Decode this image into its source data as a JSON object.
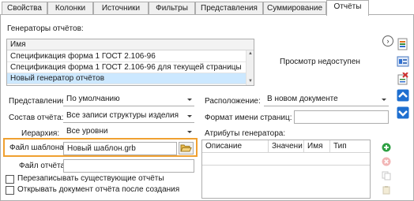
{
  "tabs": [
    {
      "label": "Свойства",
      "active": false
    },
    {
      "label": "Колонки",
      "active": false
    },
    {
      "label": "Источники",
      "active": false
    },
    {
      "label": "Фильтры",
      "active": false
    },
    {
      "label": "Представления",
      "active": false
    },
    {
      "label": "Суммирование",
      "active": false
    },
    {
      "label": "Отчёты",
      "active": true
    }
  ],
  "generators": {
    "title": "Генераторы отчётов:",
    "column_header": "Имя",
    "rows": [
      {
        "name": "Спецификация форма 1 ГОСТ 2.106-96",
        "selected": false
      },
      {
        "name": "Спецификация форма 1 ГОСТ 2.106-96 для текущей страницы",
        "selected": false
      },
      {
        "name": "Новый генератор отчётов",
        "selected": true
      }
    ]
  },
  "preview_text": "Просмотр недоступен",
  "form": {
    "representation_label": "Представление:",
    "representation_value": "По умолчанию",
    "composition_label": "Состав отчёта:",
    "composition_value": "Все записи структуры изделия",
    "hierarchy_label": "Иерархия:",
    "hierarchy_value": "Все уровни",
    "template_label": "Файл шаблона:",
    "template_value": "Новый шаблон.grb",
    "report_file_label": "Файл отчёта:",
    "report_file_value": "",
    "overwrite_label": "Перезаписывать существующие отчёты",
    "overwrite_checked": false,
    "open_after_label": "Открывать документ отчёта после создания",
    "open_after_checked": false,
    "location_label": "Расположение:",
    "location_value": "В новом документе",
    "page_name_format_label": "Формат имени страниц:",
    "page_name_format_value": "",
    "attributes_label": "Атрибуты генератора:"
  },
  "attributes_table": {
    "columns": [
      "Описание",
      "Значени",
      "Имя",
      "Тип"
    ]
  },
  "icons": {
    "nav": "chevron-right-circle-icon",
    "side": [
      "add-report-icon",
      "report-properties-icon",
      "delete-report-icon",
      "move-up-icon",
      "move-down-icon"
    ],
    "attr_actions": [
      "add-attribute-icon",
      "remove-attribute-icon",
      "copy-attribute-icon",
      "paste-attribute-icon"
    ],
    "browse": "folder-open-icon"
  },
  "colors": {
    "selection": "#cce8ff",
    "highlight": "#f0a030",
    "add_green": "#2ea043",
    "remove_red": "#e05a5a",
    "arrow_blue": "#1e6fd0"
  }
}
